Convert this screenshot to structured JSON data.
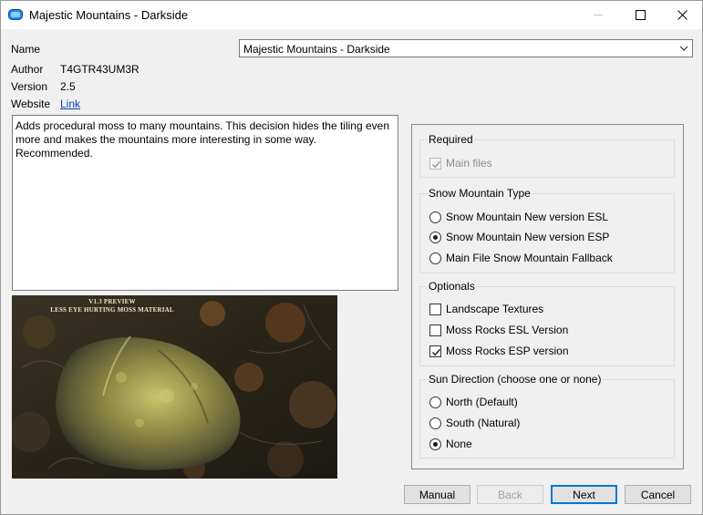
{
  "window": {
    "title": "Majestic Mountains - Darkside"
  },
  "info": {
    "name_label": "Name",
    "author_label": "Author",
    "author_value": "T4GTR43UM3R",
    "version_label": "Version",
    "version_value": "2.5",
    "website_label": "Website",
    "website_link": "Link"
  },
  "name_select": {
    "selected": "Majestic Mountains - Darkside"
  },
  "description": "Adds procedural moss to many mountains. This decision hides the tiling even more and makes the mountains more interesting in some way. Recommended.",
  "preview": {
    "line1": "V1.3 PREVIEW",
    "line2": "LESS EYE HURTING MOSS MATERIAL"
  },
  "groups": {
    "required": {
      "title": "Required",
      "options": [
        {
          "label": "Main files",
          "checked": true,
          "disabled": true
        }
      ]
    },
    "snow": {
      "title": "Snow Mountain Type",
      "options": [
        {
          "label": "Snow Mountain New version ESL",
          "selected": false
        },
        {
          "label": "Snow Mountain New version ESP",
          "selected": true
        },
        {
          "label": "Main File Snow Mountain Fallback",
          "selected": false
        }
      ]
    },
    "optionals": {
      "title": "Optionals",
      "options": [
        {
          "label": "Landscape Textures",
          "checked": false
        },
        {
          "label": "Moss Rocks ESL Version",
          "checked": false
        },
        {
          "label": "Moss Rocks ESP version",
          "checked": true
        }
      ]
    },
    "sun": {
      "title": "Sun Direction (choose one or none)",
      "options": [
        {
          "label": "North (Default)",
          "selected": false
        },
        {
          "label": "South (Natural)",
          "selected": false
        },
        {
          "label": "None",
          "selected": true
        }
      ]
    }
  },
  "buttons": {
    "manual": "Manual",
    "back": "Back",
    "next": "Next",
    "cancel": "Cancel"
  },
  "colors": {
    "link": "#0645ad",
    "focus": "#0078d7",
    "app_icon": "#1e88e5"
  }
}
